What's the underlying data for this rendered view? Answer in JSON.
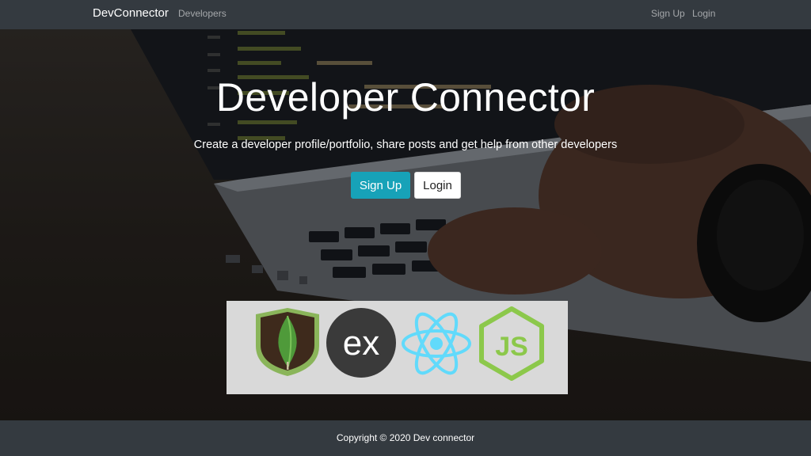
{
  "navbar": {
    "brand": "DevConnector",
    "developers": "Developers",
    "signup": "Sign Up",
    "login": "Login"
  },
  "landing": {
    "title": "Developer Connector",
    "lead": "Create a developer profile/portfolio, share posts and get help from other developers",
    "signup_button": "Sign Up",
    "login_button": "Login"
  },
  "stack_logos": {
    "express_text": "ex",
    "node_text": "JS",
    "icons": [
      "mongodb-leaf-icon",
      "express-icon",
      "react-atom-icon",
      "nodejs-hexagon-icon"
    ]
  },
  "footer": {
    "copyright": "Copyright © 2020 Dev connector"
  },
  "colors": {
    "navbar": "#343a40",
    "primary_button": "#17a2b8",
    "mongodb_green": "#4f8e3a",
    "react_blue": "#61dafb",
    "node_green": "#8cc84b"
  }
}
